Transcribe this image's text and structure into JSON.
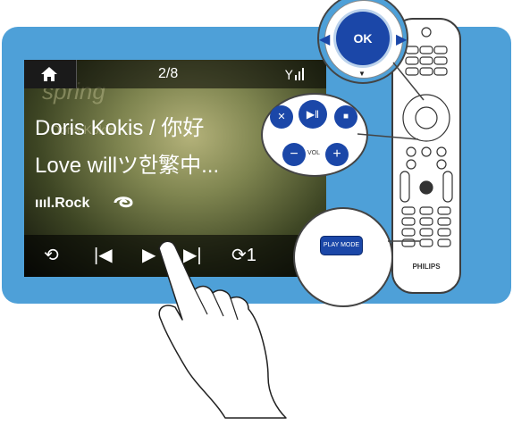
{
  "screen": {
    "page_indicator": "2/8",
    "signal_icon": "signal-icon",
    "track_title": "Doris Kokis / 你好",
    "track_subtitle": "Love willツ한繁中...",
    "genre": "ıııl.Rock",
    "album_art_text_1": "spring",
    "album_art_text_2": "Doris Kokis"
  },
  "controls": {
    "back": "⟲",
    "prev": "|◀",
    "play": "▶",
    "next": "▶|",
    "repeat": "⟳1",
    "shuffle": "✕"
  },
  "remote": {
    "ok_label": "OK",
    "vol_label": "VOL",
    "play_mode_label": "PLAY MODE",
    "brand": "PHILIPS"
  },
  "colors": {
    "panel": "#4ea0d8",
    "remote_button_blue": "#1b47a8"
  }
}
